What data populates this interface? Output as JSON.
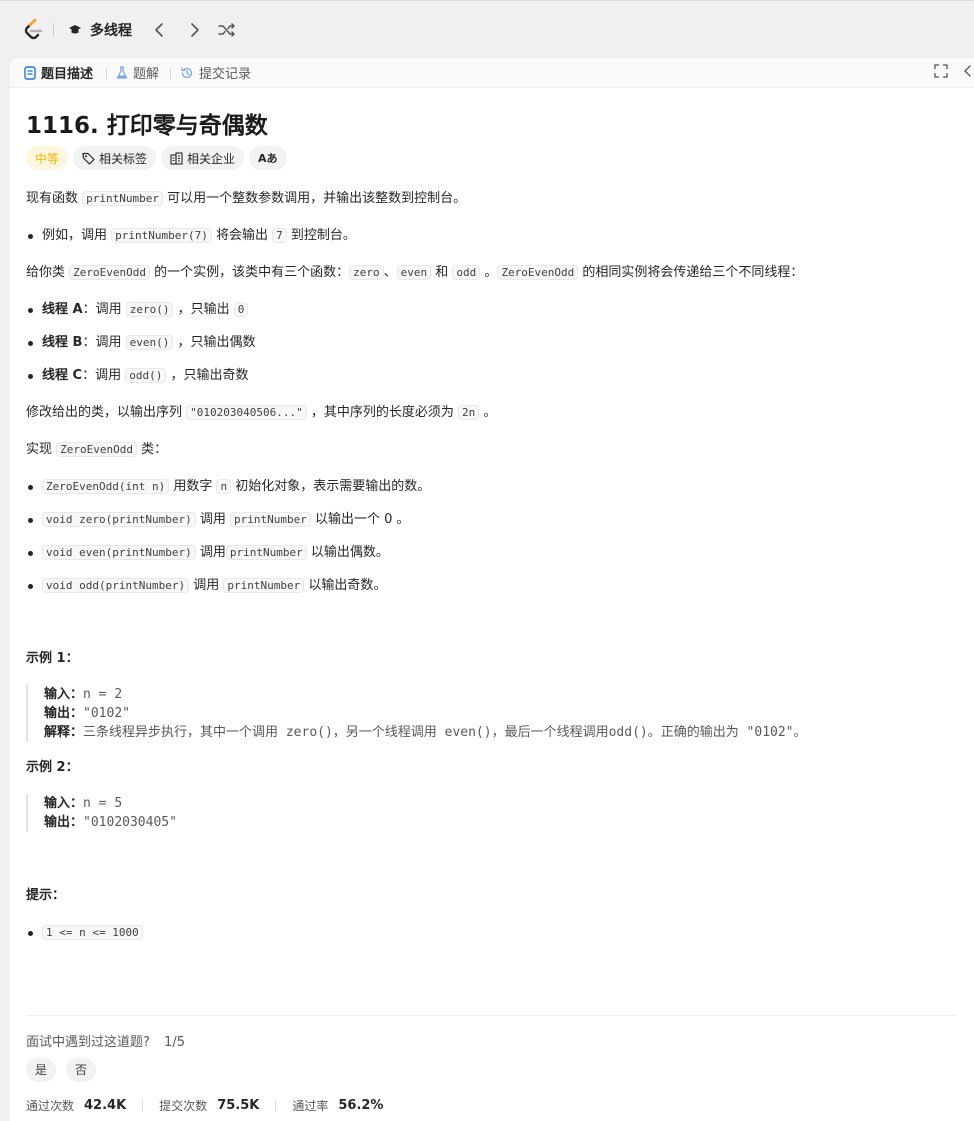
{
  "topbar": {
    "problem_list_label": "多线程"
  },
  "tabs": [
    {
      "label": "题目描述",
      "active": true
    },
    {
      "label": "题解",
      "active": false
    },
    {
      "label": "提交记录",
      "active": false
    }
  ],
  "problem": {
    "title": "1116. 打印零与奇偶数",
    "difficulty": "中等",
    "tags": [
      "相关标签",
      "相关企业"
    ],
    "font_icon": "Aあ"
  },
  "description": {
    "p1": [
      "现有函数 ",
      "printNumber",
      " 可以用一个整数参数调用，并输出该整数到控制台。"
    ],
    "b1": [
      "例如，调用 ",
      "printNumber(7)",
      " 将会输出 ",
      "7",
      " 到控制台。"
    ],
    "p2": [
      "给你类 ",
      "ZeroEvenOdd",
      " 的一个实例，该类中有三个函数：",
      "zero",
      "、",
      "even",
      " 和 ",
      "odd",
      " 。",
      "ZeroEvenOdd",
      " 的相同实例将会传递给三个不同线程："
    ],
    "threads": [
      {
        "name": "线程 A",
        "pre": "：调用 ",
        "code": "zero()",
        "post": " ，只输出 ",
        "code2": "0"
      },
      {
        "name": "线程 B",
        "pre": "：调用 ",
        "code": "even()",
        "post": " ，只输出偶数",
        "code2": ""
      },
      {
        "name": "线程 C",
        "pre": "：调用 ",
        "code": "odd()",
        "post": " ，只输出奇数",
        "code2": ""
      }
    ],
    "p3": [
      "修改给出的类，以输出序列 ",
      "\"010203040506...\"",
      " ，其中序列的长度必须为 ",
      "2n",
      " 。"
    ],
    "p4": [
      "实现 ",
      "ZeroEvenOdd",
      " 类："
    ],
    "methods": [
      {
        "code": "ZeroEvenOdd(int n)",
        "mid": " 用数字 ",
        "code2": "n",
        "tail": " 初始化对象，表示需要输出的数。"
      },
      {
        "code": "void zero(printNumber)",
        "mid": " 调用 ",
        "code2": "printNumber",
        "tail": " 以输出一个 0 。"
      },
      {
        "code": "void even(printNumber)",
        "mid": " 调用",
        "code2": "printNumber",
        "tail": " 以输出偶数。"
      },
      {
        "code": "void odd(printNumber)",
        "mid": " 调用 ",
        "code2": "printNumber",
        "tail": " 以输出奇数。"
      }
    ]
  },
  "examples": [
    {
      "title": "示例 1：",
      "lines": [
        {
          "k": "输入：",
          "v": "n = 2"
        },
        {
          "k": "输出：",
          "v": "\"0102\""
        },
        {
          "k": "解释：",
          "v": "三条线程异步执行，其中一个调用 zero()，另一个线程调用 even()，最后一个线程调用odd()。正确的输出为 \"0102\"。"
        }
      ]
    },
    {
      "title": "示例 2：",
      "lines": [
        {
          "k": "输入：",
          "v": "n = 5"
        },
        {
          "k": "输出：",
          "v": "\"0102030405\""
        }
      ]
    }
  ],
  "hints": {
    "title": "提示：",
    "items": [
      "1 <= n <= 1000"
    ]
  },
  "footer": {
    "question": "面试中遇到过这道题?",
    "progress": "1/5",
    "yes": "是",
    "no": "否",
    "stats": [
      {
        "label": "通过次数",
        "value": "42.4K"
      },
      {
        "label": "提交次数",
        "value": "75.5K"
      },
      {
        "label": "通过率",
        "value": "56.2%"
      }
    ]
  },
  "colors": {
    "difficulty": "#ffb800",
    "tab_icon": "#1a73e8"
  }
}
